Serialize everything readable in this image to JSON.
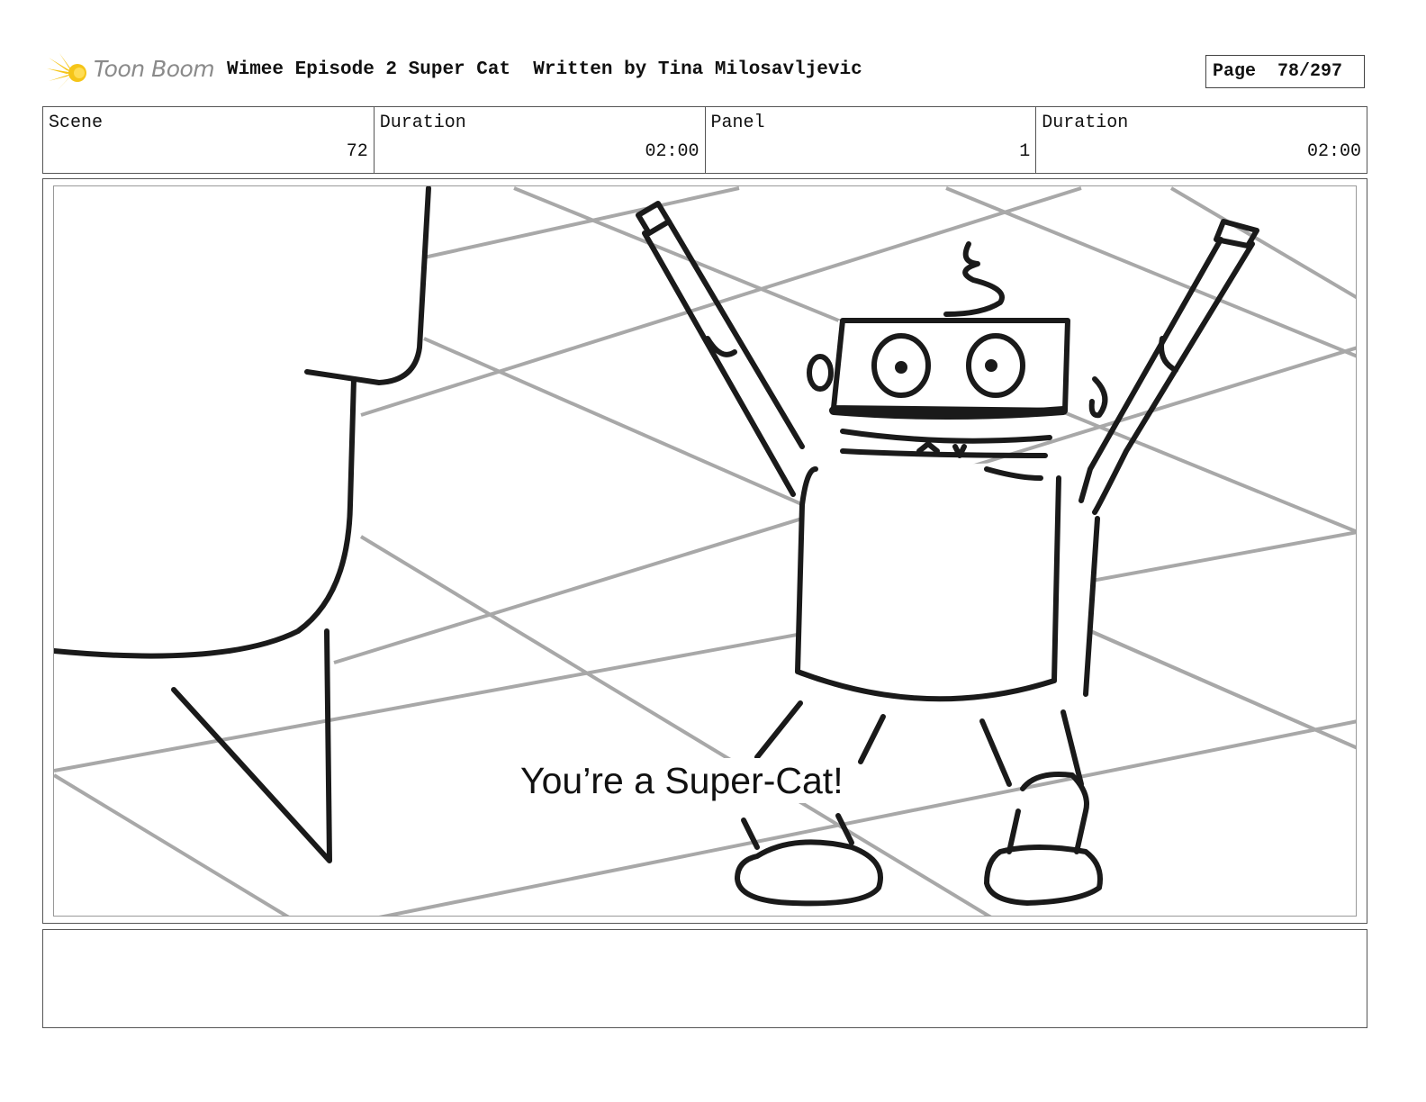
{
  "header": {
    "logo_text": "Toon Boom",
    "title": "Wimee Episode 2 Super Cat  Written by Tina Milosavljevic",
    "page_label": "Page  78/297"
  },
  "info": {
    "scene_label": "Scene",
    "scene_value": "72",
    "scene_duration_label": "Duration",
    "scene_duration_value": "02:00",
    "panel_label": "Panel",
    "panel_value": "1",
    "panel_duration_label": "Duration",
    "panel_duration_value": "02:00"
  },
  "panel": {
    "dialogue": "You’re a Super-Cat!"
  },
  "notes": {
    "text": ""
  },
  "colors": {
    "logo_yellow": "#f5c518",
    "grid_gray": "#a8a8a8",
    "ink": "#1a1a1a"
  }
}
